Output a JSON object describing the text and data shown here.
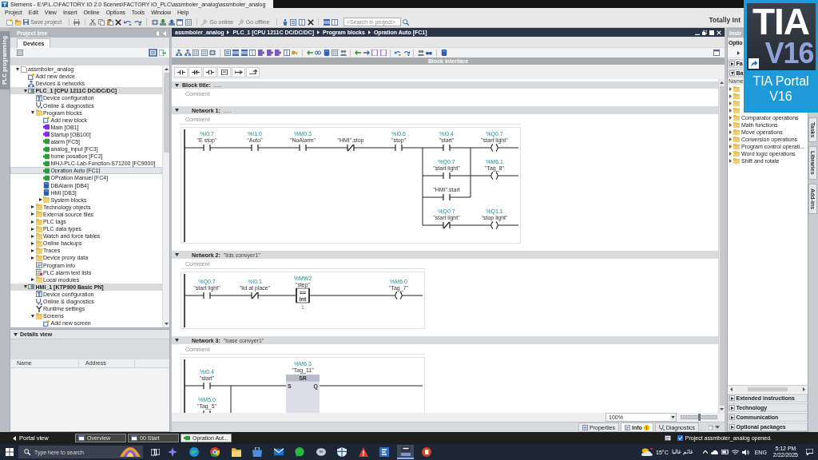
{
  "window": {
    "title": "Siemens  -  E:\\P.L.C\\FACTORY IO 2.0 Scenes\\FACTORY IO_PLC\\assmboler_analog\\assmboler_analog"
  },
  "menu": [
    "Project",
    "Edit",
    "View",
    "Insert",
    "Online",
    "Options",
    "Tools",
    "Window",
    "Help"
  ],
  "toolbar": {
    "save_label": "Save project",
    "go_online": "Go online",
    "go_offline": "Go offline",
    "search": {
      "placeholder": "<Search in project>"
    }
  },
  "brand": "Totally Int",
  "side_strip": "PLC programming",
  "project_tree": {
    "title": "Project tree",
    "tabs": [
      {
        "label": "Devices",
        "selected": true
      }
    ],
    "items": [
      {
        "label": "assmboler_analog",
        "kind": "project",
        "expanded": true,
        "selected": false,
        "children": [
          {
            "label": "Add new device",
            "kind": "add",
            "selected": false
          },
          {
            "label": "Devices & networks",
            "kind": "network",
            "selected": false
          },
          {
            "label": "PLC_1 [CPU 1211C DC/DC/DC]",
            "kind": "device",
            "expanded": true,
            "selected": false,
            "children": [
              {
                "label": "Device configuration",
                "kind": "config",
                "selected": false
              },
              {
                "label": "Online & diagnostics",
                "kind": "diagnostics",
                "selected": false
              },
              {
                "label": "Program blocks",
                "kind": "folder",
                "expanded": true,
                "selected": false,
                "children": [
                  {
                    "label": "Add new block",
                    "kind": "add",
                    "selected": false
                  },
                  {
                    "label": "Main [OB1]",
                    "kind": "ob",
                    "selected": false
                  },
                  {
                    "label": "Startup [OB100]",
                    "kind": "ob",
                    "selected": false
                  },
                  {
                    "label": "alarm [FC5]",
                    "kind": "fc",
                    "selected": false
                  },
                  {
                    "label": "analog_input [FC3]",
                    "kind": "fc",
                    "selected": false
                  },
                  {
                    "label": "home posation [FC2]",
                    "kind": "fc",
                    "selected": false
                  },
                  {
                    "label": "MHJ-PLC-Lab-Function-S71200 [FC9000]",
                    "kind": "fc",
                    "selected": false
                  },
                  {
                    "label": "Opration Auto [FC1]",
                    "kind": "fc",
                    "selected": true
                  },
                  {
                    "label": "OPration Manuel [FC4]",
                    "kind": "fc",
                    "selected": false
                  },
                  {
                    "label": "DBAlarm [DB4]",
                    "kind": "db",
                    "selected": false
                  },
                  {
                    "label": "HMI [DB3]",
                    "kind": "db",
                    "selected": false
                  },
                  {
                    "label": "System blocks",
                    "kind": "folder",
                    "expanded": false,
                    "selected": false
                  }
                ]
              },
              {
                "label": "Technology objects",
                "kind": "folder",
                "expanded": false,
                "selected": false
              },
              {
                "label": "External source files",
                "kind": "folder",
                "expanded": false,
                "selected": false
              },
              {
                "label": "PLC tags",
                "kind": "folder",
                "expanded": false,
                "selected": false
              },
              {
                "label": "PLC data types",
                "kind": "folder",
                "expanded": false,
                "selected": false
              },
              {
                "label": "Watch and force tables",
                "kind": "folder",
                "expanded": false,
                "selected": false
              },
              {
                "label": "Online backups",
                "kind": "folder",
                "expanded": false,
                "selected": false
              },
              {
                "label": "Traces",
                "kind": "folder",
                "expanded": false,
                "selected": false
              },
              {
                "label": "Device proxy data",
                "kind": "folder",
                "expanded": false,
                "selected": false
              },
              {
                "label": "Program info",
                "kind": "info",
                "selected": false
              },
              {
                "label": "PLC alarm text lists",
                "kind": "list",
                "selected": false
              },
              {
                "label": "Local modules",
                "kind": "folder",
                "expanded": false,
                "selected": false
              }
            ]
          },
          {
            "label": "HMI_1 [KTP900 Basic PN]",
            "kind": "device",
            "expanded": true,
            "selected": false,
            "children": [
              {
                "label": "Device configuration",
                "kind": "config",
                "selected": false
              },
              {
                "label": "Online & diagnostics",
                "kind": "diagnostics",
                "selected": false
              },
              {
                "label": "Runtime settings",
                "kind": "settings",
                "selected": false
              },
              {
                "label": "Screens",
                "kind": "folder",
                "expanded": true,
                "selected": false,
                "children": [
                  {
                    "label": "Add new screen",
                    "kind": "add",
                    "selected": false
                  }
                ]
              }
            ]
          }
        ]
      }
    ]
  },
  "details_view": {
    "title": "Details view",
    "expanded": true,
    "columns": [
      "Name",
      "Address"
    ]
  },
  "editor": {
    "breadcrumb": [
      "assmboler_analog",
      "PLC_1 [CPU 1211C DC/DC/DC]",
      "Program blocks",
      "Opration Auto [FC1]"
    ],
    "block_interface": "Block interface",
    "block_title": {
      "label": "Block title:",
      "title": ".....",
      "expanded": true,
      "comment": {
        "placeholder": "Comment"
      }
    },
    "networks": [
      {
        "label": "Network 1:",
        "title": ".....",
        "expanded": true,
        "comment": {
          "placeholder": "Comment"
        },
        "series": [
          {
            "kind": "no_contact",
            "address": "%I0.7",
            "tag": "\"E stop\""
          },
          {
            "kind": "no_contact",
            "address": "%I1.0",
            "tag": "\"Auto\""
          },
          {
            "kind": "no_contact",
            "address": "%M0.3",
            "tag": "\"NoAlarm\""
          },
          {
            "kind": "nc_contact",
            "tag": "\"HMI\".stop"
          },
          {
            "kind": "no_contact",
            "address": "%I0.6",
            "tag": "\"stop\""
          }
        ],
        "outputs": [
          {
            "contacts": [
              {
                "kind": "no_contact",
                "address": "%I0.4",
                "tag": "\"start\""
              },
              {
                "kind": "no_contact",
                "address": "%Q0.7",
                "tag": "\"start light\""
              },
              {
                "kind": "no_contact",
                "tag": "\"HMI\".start"
              }
            ],
            "coils": [
              {
                "kind": "coil",
                "address": "%Q0.7",
                "tag": "\"start light\""
              },
              {
                "kind": "coil",
                "address": "%M6.1",
                "tag": "\"Tag_8\""
              }
            ]
          },
          {
            "contacts": [
              {
                "kind": "nc_contact",
                "address": "%Q0.7",
                "tag": "\"start light\""
              }
            ],
            "coils": [
              {
                "kind": "coil",
                "address": "%Q1.1",
                "tag": "\"stop light\""
              }
            ]
          }
        ]
      },
      {
        "label": "Network 2:",
        "title": "\"lids convyer1\"",
        "expanded": true,
        "comment": {
          "placeholder": "Comment"
        },
        "series": [
          {
            "kind": "no_contact",
            "address": "%Q0.7",
            "tag": "\"start light\""
          },
          {
            "kind": "nc_contact",
            "address": "%I0.1",
            "tag": "\"lid at place\""
          },
          {
            "kind": "compare",
            "address": "%MW2",
            "tag": "\"step\"",
            "operator": "==",
            "type": "Int",
            "value": "1"
          }
        ],
        "outputs": [
          {
            "coils": [
              {
                "kind": "coil",
                "address": "%M6.0",
                "tag": "\"Tag_7\""
              }
            ]
          }
        ]
      },
      {
        "label": "Network 3:",
        "title": "\"base convyer1\"",
        "expanded": true,
        "comment": {
          "placeholder": "Comment"
        },
        "series": [
          {
            "kind": "parallel",
            "rows": [
              {
                "kind": "no_contact",
                "address": "%I0.4",
                "tag": "\"start\""
              },
              {
                "kind": "no_contact",
                "address": "%M5.0",
                "tag": "\"Tag_5\""
              }
            ]
          },
          {
            "kind": "sr_box",
            "address": "%M6.3",
            "tag": "\"Tag_11\"",
            "label": "SR",
            "pins": [
              "S",
              "Q"
            ]
          }
        ]
      }
    ],
    "zoom": {
      "value": "100%",
      "level": 0.5
    }
  },
  "inspector_tabs": [
    {
      "label": "Properties",
      "kind": "properties",
      "selected": false,
      "notice": false
    },
    {
      "label": "Info",
      "kind": "info",
      "selected": true,
      "notice": true
    },
    {
      "label": "Diagnostics",
      "kind": "diagnostics",
      "selected": false,
      "notice": false
    }
  ],
  "instructions": {
    "title": "Instr",
    "options": "Optio",
    "sections": [
      {
        "label": "Fa",
        "expanded": false
      },
      {
        "label": "Ba",
        "expanded": true
      }
    ],
    "column": "Name",
    "items": [
      {
        "expanded": false
      },
      {
        "expanded": false
      },
      {
        "expanded": false
      },
      {
        "expanded": false
      },
      {
        "label": "Comparator operations",
        "expanded": false
      },
      {
        "label": "Math functions",
        "expanded": false
      },
      {
        "label": "Move operations",
        "expanded": false
      },
      {
        "label": "Conversion operations",
        "expanded": false
      },
      {
        "label": "Program control operati...",
        "expanded": false
      },
      {
        "label": "Word logic operations",
        "expanded": false
      },
      {
        "label": "Shift and rotate",
        "expanded": false
      }
    ],
    "packages": [
      {
        "label": "Extended instructions",
        "expanded": false
      },
      {
        "label": "Technology",
        "expanded": false
      },
      {
        "label": "Communication",
        "expanded": false
      },
      {
        "label": "Optional packages",
        "expanded": false
      }
    ]
  },
  "side_tabs": [
    "Tasks",
    "Libraries",
    "Add-ins"
  ],
  "portal_bar": {
    "portal_view": "Portal view",
    "tabs": [
      {
        "label": "Overview",
        "kind": "window",
        "selected": false
      },
      {
        "label": "00 Start",
        "kind": "window",
        "selected": false
      },
      {
        "label": "Opration Aut...",
        "kind": "block",
        "selected": true
      }
    ],
    "status": "Project assmboler_analog opened."
  },
  "taskbar": {
    "search": {
      "placeholder": "Type here to search"
    },
    "apps": [
      {
        "kind": "sparkle",
        "selected": false
      },
      {
        "kind": "swirl",
        "selected": false
      },
      {
        "kind": "ring",
        "selected": false
      },
      {
        "kind": "folder",
        "selected": false
      },
      {
        "kind": "bag",
        "selected": false
      },
      {
        "kind": "mail",
        "selected": false
      },
      {
        "kind": "chat",
        "selected": false
      },
      {
        "kind": "disc",
        "selected": false
      },
      {
        "kind": "shield",
        "selected": false
      },
      {
        "kind": "warning",
        "selected": false
      },
      {
        "kind": "tile",
        "selected": false
      },
      {
        "kind": "tia",
        "selected": true
      },
      {
        "kind": "slide",
        "selected": false
      }
    ],
    "weather": {
      "temperature": "15°C",
      "condition": "غائم غالبا"
    },
    "language": "ENG",
    "time": "5:12 PM",
    "date": "2/22/2025"
  },
  "desktop_shortcut": {
    "logo_top": "TIA",
    "logo_bottom": "V16",
    "label": "TIA Portal V16"
  }
}
